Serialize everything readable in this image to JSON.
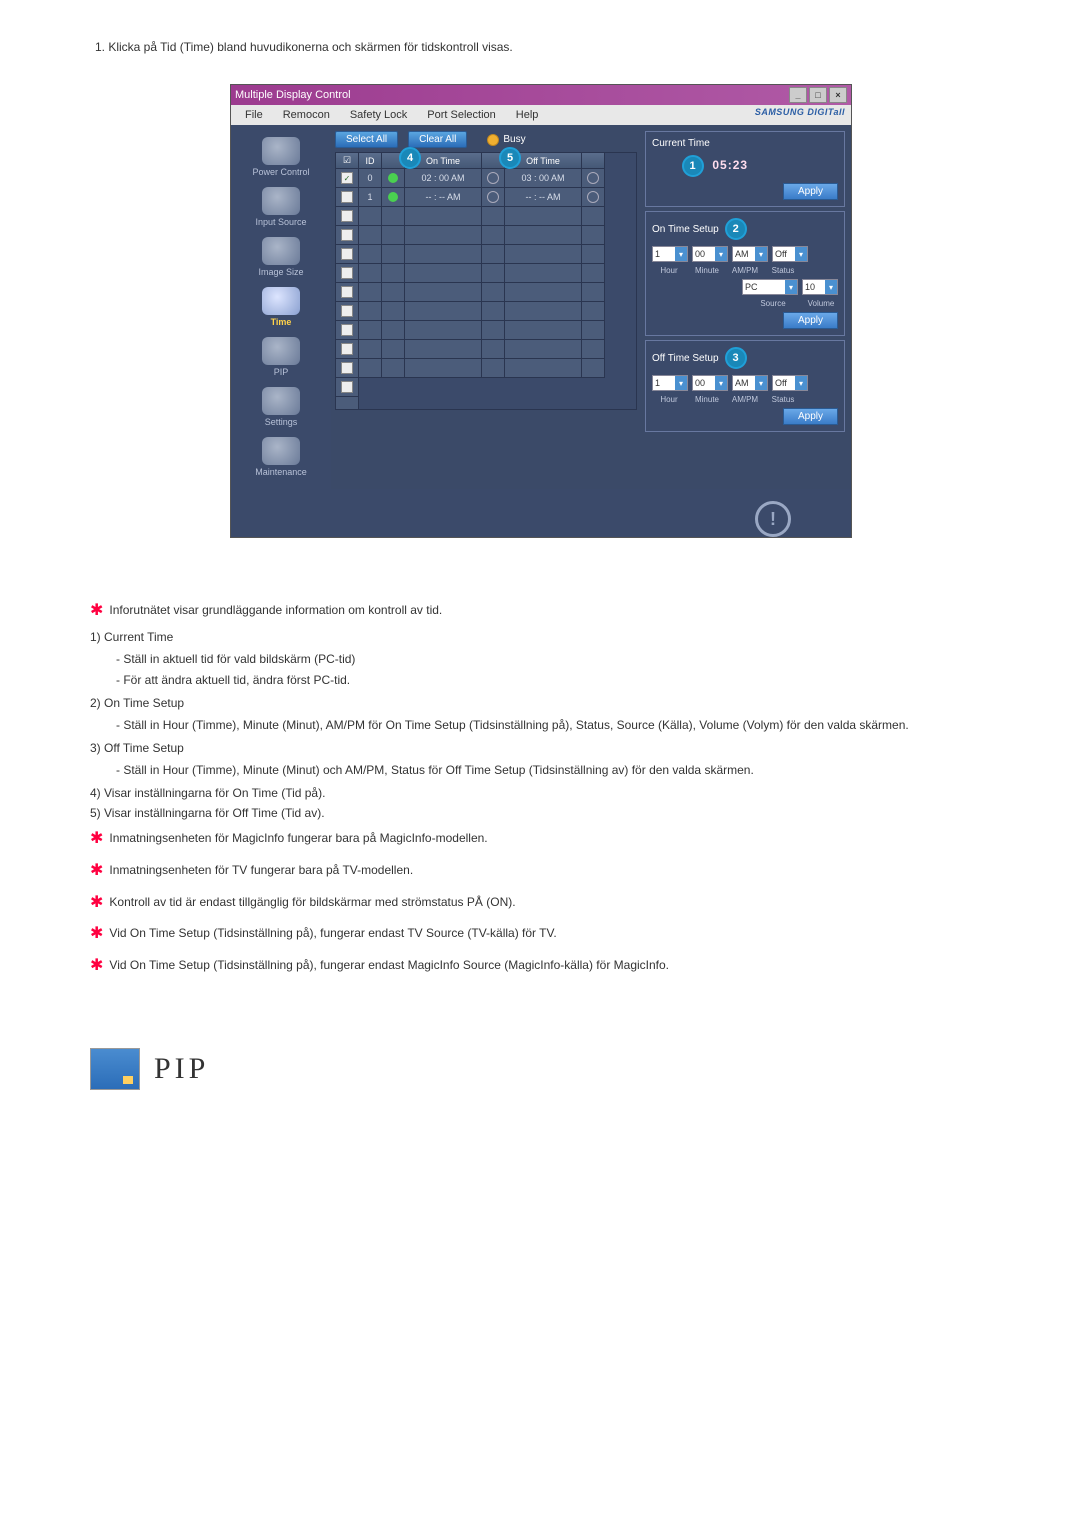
{
  "intro": "1.  Klicka på Tid (Time) bland huvudikonerna och skärmen för tidskontroll visas.",
  "window": {
    "title": "Multiple Display Control",
    "menus": {
      "file": "File",
      "remocon": "Remocon",
      "safety": "Safety Lock",
      "port": "Port Selection",
      "help": "Help"
    },
    "brand": "SAMSUNG DIGITall"
  },
  "sidebar": {
    "power": "Power Control",
    "input": "Input Source",
    "image": "Image Size",
    "time": "Time",
    "pip": "PIP",
    "settings": "Settings",
    "maint": "Maintenance"
  },
  "toolbar": {
    "select_all": "Select All",
    "clear_all": "Clear All",
    "busy": "Busy"
  },
  "grid": {
    "head": {
      "chk_icon": "☑",
      "id": "ID",
      "on": "On Time",
      "off": "Off Time"
    },
    "rows": [
      {
        "checked": true,
        "id": "0",
        "st": "green",
        "on": "02 : 00 AM",
        "d1": "ring",
        "off": "03 : 00 AM",
        "d2": "ring"
      },
      {
        "checked": false,
        "id": "1",
        "st": "green",
        "on": "-- : -- AM",
        "d1": "ring",
        "off": "-- : -- AM",
        "d2": "ring"
      }
    ],
    "badges": {
      "on": "4",
      "off": "5"
    }
  },
  "panels": {
    "current_time": {
      "title": "Current Time",
      "badge": "1",
      "value": "05:23",
      "apply": "Apply"
    },
    "on_time": {
      "title": "On Time Setup",
      "badge": "2",
      "hour": "1",
      "minute": "00",
      "ampm": "AM",
      "status": "Off",
      "lbl_hour": "Hour",
      "lbl_minute": "Minute",
      "lbl_ampm": "AM/PM",
      "lbl_status": "Status",
      "source": "PC",
      "volume": "10",
      "lbl_source": "Source",
      "lbl_volume": "Volume",
      "apply": "Apply"
    },
    "off_time": {
      "title": "Off Time Setup",
      "badge": "3",
      "hour": "1",
      "minute": "00",
      "ampm": "AM",
      "status": "Off",
      "lbl_hour": "Hour",
      "lbl_minute": "Minute",
      "lbl_ampm": "AM/PM",
      "lbl_status": "Status",
      "apply": "Apply"
    }
  },
  "doc": {
    "star1": "Inforutnätet visar grundläggande information om kontroll av tid.",
    "n1": "1)  Current Time",
    "n1a": "Ställ in aktuell tid för vald bildskärm (PC-tid)",
    "n1b": "För att ändra aktuell tid, ändra först PC-tid.",
    "n2": "2)  On Time Setup",
    "n2a": "Ställ in Hour (Timme), Minute (Minut), AM/PM för On Time Setup (Tidsinställning på), Status, Source (Källa), Volume (Volym) för den valda skärmen.",
    "n3": "3)  Off Time Setup",
    "n3a": "Ställ in Hour (Timme), Minute (Minut) och AM/PM, Status för Off Time Setup (Tidsinställning av) för den valda skärmen.",
    "n4": "4)  Visar inställningarna för On Time (Tid på).",
    "n5": "5)  Visar inställningarna för Off Time (Tid av).",
    "star2": "Inmatningsenheten för MagicInfo fungerar bara på MagicInfo-modellen.",
    "star3": "Inmatningsenheten för TV fungerar bara på TV-modellen.",
    "star4": "Kontroll av tid är endast tillgänglig för bildskärmar med strömstatus PÅ (ON).",
    "star5": "Vid On Time Setup (Tidsinställning på), fungerar endast TV Source (TV-källa) för TV.",
    "star6": "Vid On Time Setup (Tidsinställning på), fungerar endast MagicInfo Source (MagicInfo-källa) för MagicInfo."
  },
  "pip": {
    "title": "PIP"
  }
}
